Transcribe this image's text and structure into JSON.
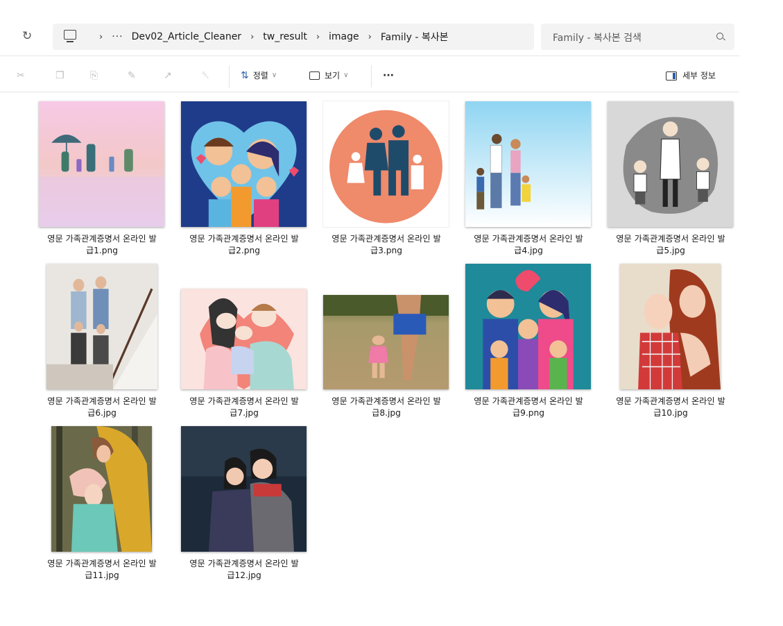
{
  "address_bar": {
    "refresh_icon": "refresh-icon",
    "computer_icon": "computer-icon",
    "overflow": "···",
    "breadcrumbs": [
      "Dev02_Article_Cleaner",
      "tw_result",
      "image",
      "Family - 복사본"
    ]
  },
  "search": {
    "placeholder": "Family - 복사본 검색",
    "icon": "search-icon"
  },
  "toolbar": {
    "cut_icon": "cut-icon",
    "copy_icon": "copy-icon",
    "paste_icon": "paste-icon",
    "rename_icon": "rename-icon",
    "share_icon": "share-icon",
    "delete_icon": "delete-icon",
    "sort_label": "정렬",
    "view_label": "보기",
    "more_label": "···",
    "details_label": "세부 정보"
  },
  "files": [
    {
      "line1": "영문 가족관계증명서 온라인 발",
      "line2": "급1.png"
    },
    {
      "line1": "영문 가족관계증명서 온라인 발",
      "line2": "급2.png"
    },
    {
      "line1": "영문 가족관계증명서 온라인 발",
      "line2": "급3.png"
    },
    {
      "line1": "영문 가족관계증명서 온라인 발",
      "line2": "급4.jpg"
    },
    {
      "line1": "영문 가족관계증명서 온라인 발",
      "line2": "급5.jpg"
    },
    {
      "line1": "영문 가족관계증명서 온라인 발",
      "line2": "급6.jpg"
    },
    {
      "line1": "영문 가족관계증명서 온라인 발",
      "line2": "급7.jpg"
    },
    {
      "line1": "영문 가족관계증명서 온라인 발",
      "line2": "급8.jpg"
    },
    {
      "line1": "영문 가족관계증명서 온라인 발",
      "line2": "급9.png"
    },
    {
      "line1": "영문 가족관계증명서 온라인 발",
      "line2": "급10.jpg"
    },
    {
      "line1": "영문 가족관계증명서 온라인 발",
      "line2": "급11.jpg"
    },
    {
      "line1": "영문 가족관계증명서 온라인 발",
      "line2": "급12.jpg"
    }
  ]
}
